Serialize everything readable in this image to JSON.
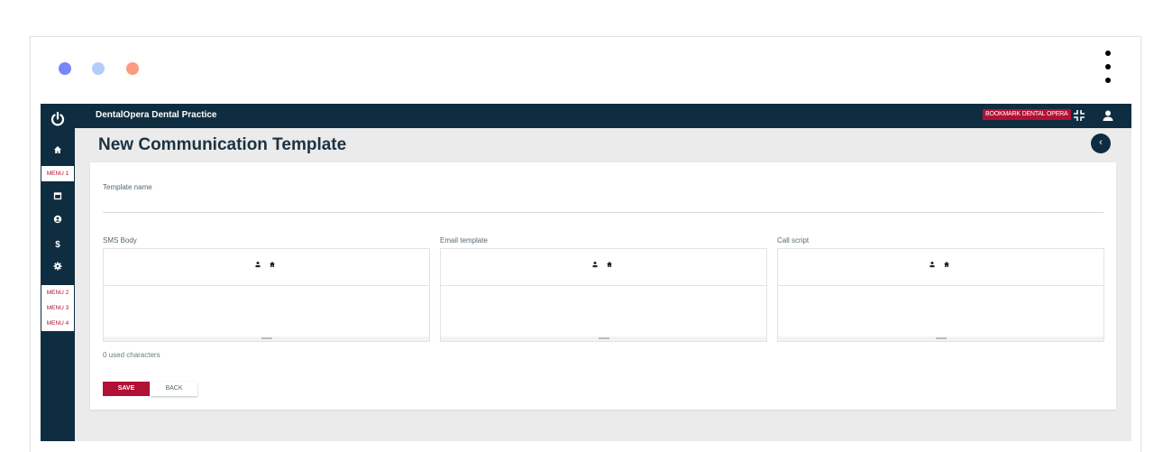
{
  "window": {
    "dots": [
      {
        "color": "#7b86f5"
      },
      {
        "color": "#b3cdfa"
      },
      {
        "color": "#fb9a82"
      }
    ],
    "menu_icon": "kebab-menu-icon"
  },
  "header": {
    "title": "DentalOpera Dental Practice",
    "bookmark_label": "BOOKMARK DENTAL OPERA",
    "icons": [
      "compress-icon",
      "user-icon"
    ]
  },
  "sidebar": {
    "top_icon": "power-icon",
    "home_icon": "home-icon",
    "menu1_label": "MENU 1",
    "icons": [
      "calendar-icon",
      "account-icon",
      "dollar-icon",
      "gear-icon"
    ],
    "menus": [
      "MENU 2",
      "MENU 3",
      "MENU 4"
    ]
  },
  "page": {
    "title": "New Communication Template",
    "collapse_icon": "chevron-left-icon"
  },
  "form": {
    "template_name_label": "Template name",
    "editors": [
      {
        "label": "SMS Body"
      },
      {
        "label": "Email template"
      },
      {
        "label": "Call script"
      }
    ],
    "counter_text": "0 used characters",
    "save_label": "SAVE",
    "back_label": "BACK"
  },
  "colors": {
    "navy": "#0f2d40",
    "accent": "#b21035",
    "background": "#ebebeb"
  }
}
